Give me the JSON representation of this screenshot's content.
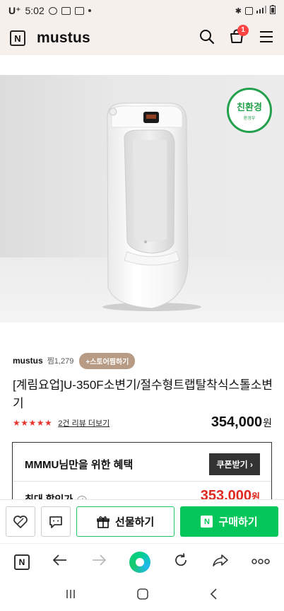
{
  "status_bar": {
    "carrier": "U⁺",
    "time": "5:02"
  },
  "header": {
    "title": "mustus",
    "cart_count": "1",
    "logo_letter": "N"
  },
  "product_image": {
    "eco_badge_main": "친환경",
    "eco_badge_sub": "환경부"
  },
  "seller": {
    "name": "mustus",
    "likes": "찜1,279",
    "store_fav_label": "+스토어찜하기"
  },
  "product": {
    "title": "[계림요업]U-350F소변기/절수형트랩탈착식스톨소변기",
    "stars": "★★★★★",
    "review_link": "2건 리뷰 더보기",
    "price": "354,000",
    "currency": "원"
  },
  "benefit": {
    "title": "MMMU님만을 위한 혜택",
    "coupon_label": "쿠폰받기",
    "max_discount_label": "최대 할인가",
    "max_discount_price": "353,000",
    "currency": "원"
  },
  "actions": {
    "gift_label": "선물하기",
    "buy_label": "구매하기"
  },
  "browser": {
    "logo_letter": "N"
  },
  "colors": {
    "accent_green": "#03c75a",
    "header_bg": "#f6f0ec",
    "price_red": "#e0281e",
    "star_red": "#e8342f"
  }
}
